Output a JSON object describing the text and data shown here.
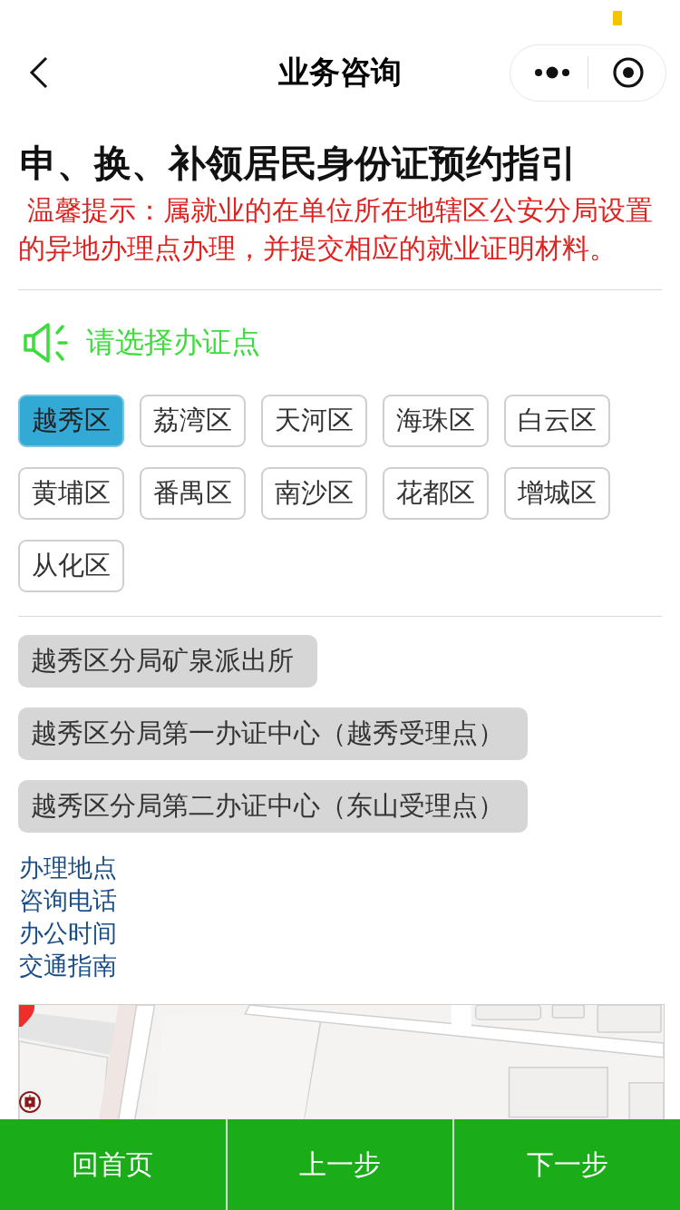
{
  "nav_bar": {
    "title": "业务咨询"
  },
  "heading": "申、换、补领居民身份证预约指引",
  "notice": "温馨提示：属就业的在单位所在地辖区公安分局设置的异地办理点办理，并提交相应的就业证明材料。",
  "section_label": "请选择办证点",
  "districts": [
    {
      "label": "越秀区",
      "selected": true
    },
    {
      "label": "荔湾区",
      "selected": false
    },
    {
      "label": "天河区",
      "selected": false
    },
    {
      "label": "海珠区",
      "selected": false
    },
    {
      "label": "白云区",
      "selected": false
    },
    {
      "label": "黄埔区",
      "selected": false
    },
    {
      "label": "番禺区",
      "selected": false
    },
    {
      "label": "南沙区",
      "selected": false
    },
    {
      "label": "花都区",
      "selected": false
    },
    {
      "label": "增城区",
      "selected": false
    },
    {
      "label": "从化区",
      "selected": false
    }
  ],
  "offices": [
    "越秀区分局矿泉派出所",
    "越秀区分局第一办证中心（越秀受理点）",
    "越秀区分局第二办证中心（东山受理点）"
  ],
  "info_links": [
    "办理地点",
    "咨询电话",
    "办公时间",
    "交通指南"
  ],
  "footer_buttons": [
    "回首页",
    "上一步",
    "下一步"
  ]
}
